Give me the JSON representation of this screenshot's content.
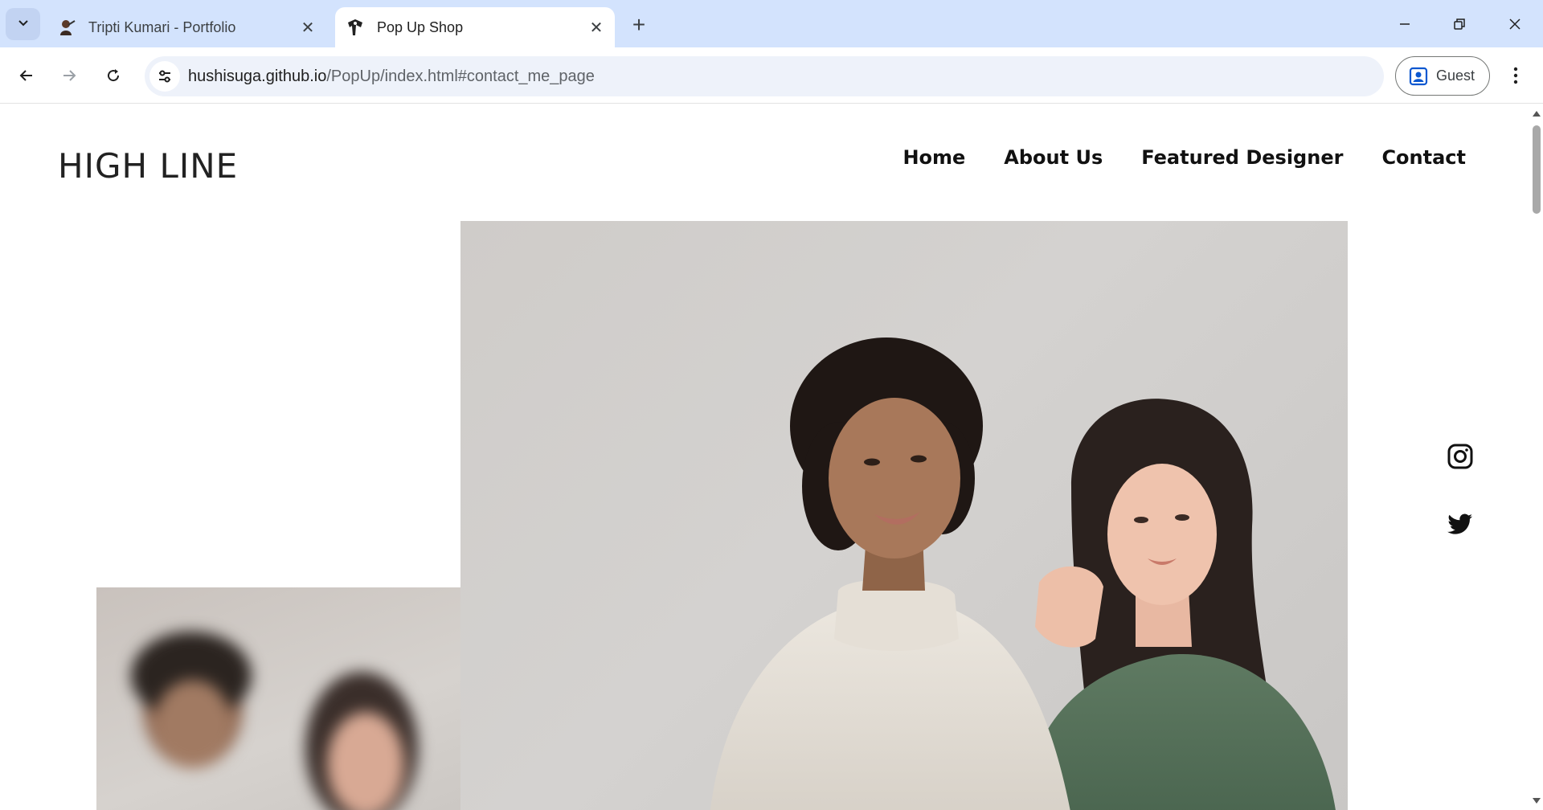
{
  "browser": {
    "tabs": [
      {
        "title": "Tripti Kumari - Portfolio",
        "active": false,
        "favicon": "portrait-favicon-icon"
      },
      {
        "title": "Pop Up Shop",
        "active": true,
        "favicon": "shop-favicon-icon"
      }
    ],
    "url_host": "hushisuga.github.io",
    "url_path": "/PopUp/index.html#contact_me_page",
    "profile_label": "Guest",
    "accent": "#d3e3fd"
  },
  "page": {
    "brand": "HIGH LINE",
    "nav": [
      "Home",
      "About Us",
      "Featured Designer",
      "Contact"
    ],
    "hero_image_alt": "Two women posing together, one in a cream ribbed sweater and one in a green ribbed top",
    "social": [
      "instagram-icon",
      "twitter-icon"
    ]
  }
}
